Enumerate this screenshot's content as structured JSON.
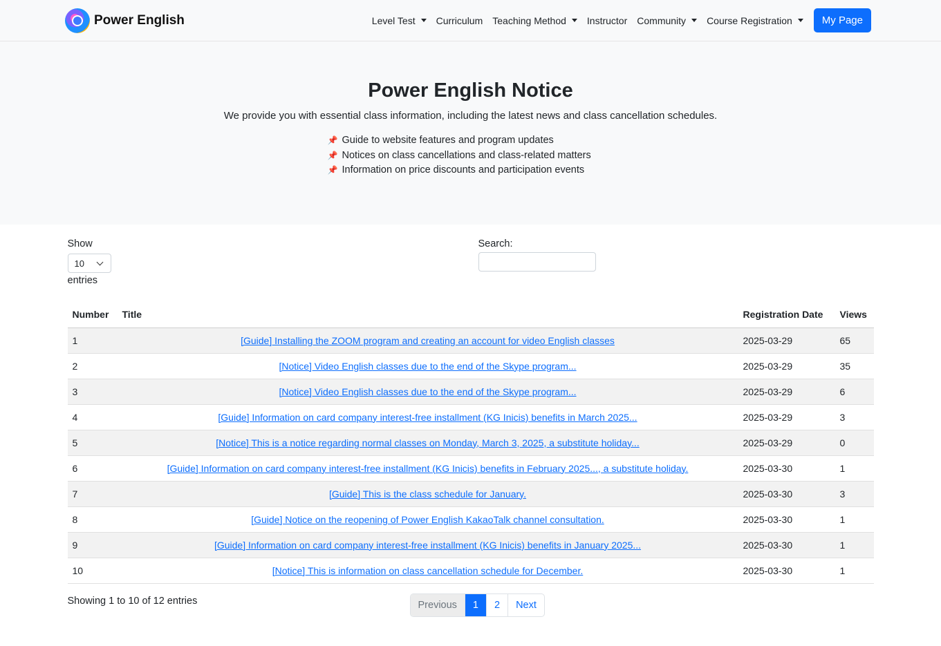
{
  "header": {
    "brand": "Power English",
    "nav": [
      {
        "label": "Level Test",
        "dropdown": true
      },
      {
        "label": "Curriculum",
        "dropdown": false
      },
      {
        "label": "Teaching Method",
        "dropdown": true
      },
      {
        "label": "Instructor",
        "dropdown": false
      },
      {
        "label": "Community",
        "dropdown": true
      },
      {
        "label": "Course Registration",
        "dropdown": true
      }
    ],
    "my_page": "My Page"
  },
  "hero": {
    "title": "Power English Notice",
    "description": "We provide you with essential class information, including the latest news and class cancellation schedules.",
    "bullets": [
      "Guide to website features and program updates",
      "Notices on class cancellations and class-related matters",
      "Information on price discounts and participation events"
    ],
    "bullet_icon": "📌"
  },
  "controls": {
    "show_label": "Show",
    "entries_value": "10",
    "entries_label": "entries",
    "search_label": "Search:",
    "search_value": ""
  },
  "table": {
    "columns": [
      "Number",
      "Title",
      "Registration Date",
      "Views"
    ],
    "rows": [
      {
        "number": "1",
        "title": "[Guide] Installing the ZOOM program and creating an account for video English classes",
        "date": "2025-03-29",
        "views": "65"
      },
      {
        "number": "2",
        "title": "[Notice] Video English classes due to the end of the Skype program...",
        "date": "2025-03-29",
        "views": "35"
      },
      {
        "number": "3",
        "title": "[Notice] Video English classes due to the end of the Skype program...",
        "date": "2025-03-29",
        "views": "6"
      },
      {
        "number": "4",
        "title": "[Guide] Information on card company interest-free installment (KG Inicis) benefits in March 2025...",
        "date": "2025-03-29",
        "views": "3"
      },
      {
        "number": "5",
        "title": "[Notice] This is a notice regarding normal classes on Monday, March 3, 2025, a substitute holiday...",
        "date": "2025-03-29",
        "views": "0"
      },
      {
        "number": "6",
        "title": "[Guide] Information on card company interest-free installment (KG Inicis) benefits in February 2025..., a substitute holiday.",
        "date": "2025-03-30",
        "views": "1"
      },
      {
        "number": "7",
        "title": "[Guide] This is the class schedule for January.",
        "date": "2025-03-30",
        "views": "3"
      },
      {
        "number": "8",
        "title": "[Guide] Notice on the reopening of Power English KakaoTalk channel consultation.",
        "date": "2025-03-30",
        "views": "1"
      },
      {
        "number": "9",
        "title": "[Guide] Information on card company interest-free installment (KG Inicis) benefits in January 2025...",
        "date": "2025-03-30",
        "views": "1"
      },
      {
        "number": "10",
        "title": "[Notice] This is information on class cancellation schedule for December.",
        "date": "2025-03-30",
        "views": "1"
      }
    ]
  },
  "footer": {
    "info": "Showing 1 to 10 of 12 entries",
    "pagination": {
      "previous": "Previous",
      "pages": [
        "1",
        "2"
      ],
      "active": "1",
      "next": "Next"
    }
  }
}
